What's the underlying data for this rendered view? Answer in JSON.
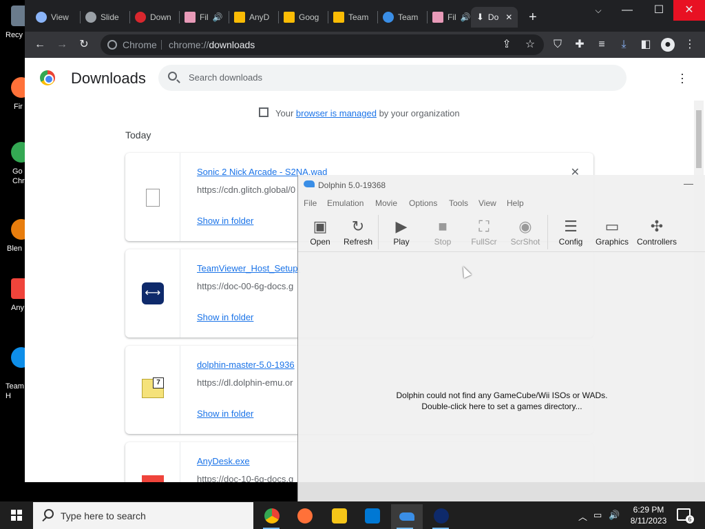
{
  "desktop": {
    "icons": [
      {
        "label": "Recy",
        "icon": "recycle-bin-icon"
      },
      {
        "label": "Fir",
        "icon": "firefox-icon"
      },
      {
        "label": "Go\nChr",
        "icon": "chrome-icon"
      },
      {
        "label": "Blen",
        "icon": "blender-icon"
      },
      {
        "label": "Any",
        "icon": "anydesk-icon"
      },
      {
        "label": "Team\nH",
        "icon": "teamviewer-icon"
      }
    ]
  },
  "chrome": {
    "tabs": [
      {
        "label": "View",
        "icon": "at-icon"
      },
      {
        "label": "Slide",
        "icon": "globe-icon"
      },
      {
        "label": "Down",
        "icon": "mega-icon"
      },
      {
        "label": "Fil",
        "icon": "anime-icon"
      },
      {
        "label": "AnyD",
        "icon": "drive-icon"
      },
      {
        "label": "Goog",
        "icon": "drive-icon"
      },
      {
        "label": "Team",
        "icon": "drive-icon"
      },
      {
        "label": "Team",
        "icon": "dolphin-icon"
      },
      {
        "label": "Fil",
        "icon": "anime-icon"
      },
      {
        "label": "Do",
        "icon": "download-icon",
        "active": true
      }
    ],
    "new_tab": "+",
    "omnibox": {
      "chip": "Chrome",
      "url_prefix": "chrome://",
      "url_path": "downloads"
    },
    "window_controls": {
      "minimize": "—",
      "maximize": "☐",
      "close": "✕"
    }
  },
  "downloads": {
    "title": "Downloads",
    "search_placeholder": "Search downloads",
    "managed": {
      "prefix": "Your ",
      "link": "browser is managed",
      "suffix": " by your organization"
    },
    "section": "Today",
    "items": [
      {
        "name": "Sonic 2 Nick Arcade - S2NA.wad",
        "url": "https://cdn.glitch.global/0",
        "show": "Show in folder",
        "icon": "file-icon"
      },
      {
        "name": "TeamViewer_Host_Setup.",
        "url": "https://doc-00-6g-docs.g",
        "show": "Show in folder",
        "icon": "teamviewer-icon"
      },
      {
        "name": "dolphin-master-5.0-1936",
        "url": "https://dl.dolphin-emu.or",
        "show": "Show in folder",
        "icon": "7z-archive-icon"
      },
      {
        "name": "AnyDesk.exe",
        "url": "https://doc-10-6g-docs.g",
        "show": "",
        "icon": "anydesk-icon"
      }
    ]
  },
  "dolphin": {
    "title": "Dolphin 5.0-19368",
    "menu": [
      "File",
      "Emulation",
      "Movie",
      "Options",
      "Tools",
      "View",
      "Help"
    ],
    "toolbar": [
      {
        "label": "Open",
        "icon": "folder-icon",
        "enabled": true
      },
      {
        "label": "Refresh",
        "icon": "refresh-icon",
        "enabled": true
      },
      {
        "label": "Play",
        "icon": "play-icon",
        "enabled": true
      },
      {
        "label": "Stop",
        "icon": "stop-icon",
        "enabled": false
      },
      {
        "label": "FullScr",
        "icon": "fullscreen-icon",
        "enabled": false
      },
      {
        "label": "ScrShot",
        "icon": "camera-icon",
        "enabled": false
      },
      {
        "label": "Config",
        "icon": "sliders-icon",
        "enabled": true
      },
      {
        "label": "Graphics",
        "icon": "monitor-icon",
        "enabled": true
      },
      {
        "label": "Controllers",
        "icon": "gamepad-icon",
        "enabled": true
      }
    ],
    "empty_line1": "Dolphin could not find any GameCube/Wii ISOs or WADs.",
    "empty_line2": "Double-click here to set a games directory..."
  },
  "taskbar": {
    "search_placeholder": "Type here to search",
    "apps": [
      "chrome-icon",
      "firefox-icon",
      "file-explorer-icon",
      "store-icon",
      "dolphin-icon",
      "teamviewer-icon"
    ],
    "time": "6:29 PM",
    "date": "8/11/2023",
    "notification_count": "6"
  }
}
